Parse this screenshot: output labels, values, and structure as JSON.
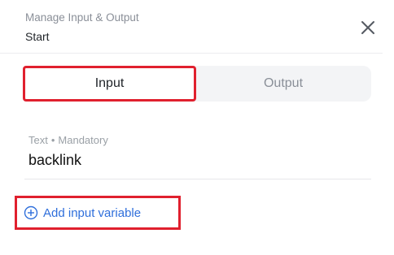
{
  "header": {
    "subtitle": "Manage Input & Output",
    "title": "Start"
  },
  "tabs": [
    {
      "label": "Input",
      "active": true
    },
    {
      "label": "Output",
      "active": false
    }
  ],
  "field": {
    "type": "Text",
    "separator": "•",
    "requirement": "Mandatory",
    "value": "backlink"
  },
  "add_variable": {
    "label": "Add input variable"
  },
  "colors": {
    "highlight": "#e0202e",
    "link": "#2f6fdb",
    "muted": "#8a8f98"
  }
}
